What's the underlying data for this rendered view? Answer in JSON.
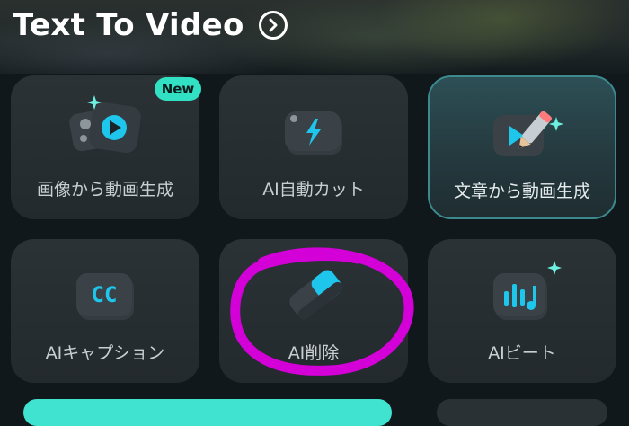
{
  "header": {
    "title": "Text To Video",
    "arrow_icon": "chevron-right-circle-icon"
  },
  "tools": [
    {
      "label": "画像から動画生成",
      "icon": "image-to-video-icon",
      "badge": "New",
      "selected": false
    },
    {
      "label": "AI自動カット",
      "icon": "ai-auto-cut-icon",
      "selected": false
    },
    {
      "label": "文章から動画生成",
      "icon": "text-to-video-icon",
      "selected": true
    },
    {
      "label": "AIキャプション",
      "icon": "cc-caption-icon",
      "selected": false
    },
    {
      "label": "AI削除",
      "icon": "eraser-icon",
      "selected": false
    },
    {
      "label": "AIビート",
      "icon": "music-beat-icon",
      "selected": false
    }
  ],
  "colors": {
    "accent": "#32e0c4",
    "annotation": "#d400d8",
    "card_bg": "#262d31",
    "background": "#11181c"
  }
}
